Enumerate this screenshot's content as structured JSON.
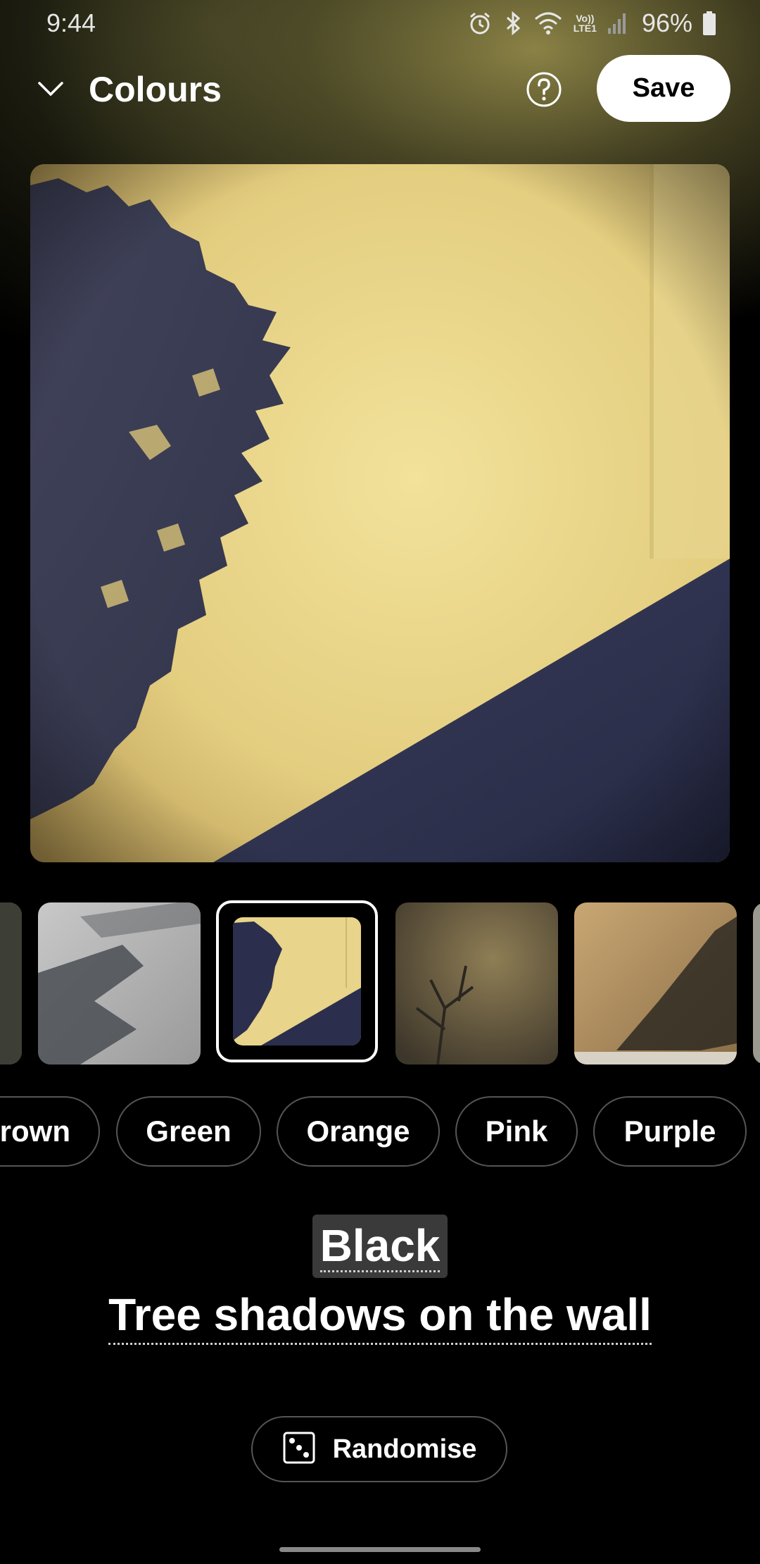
{
  "status_bar": {
    "time": "9:44",
    "battery": "96%",
    "icons": [
      "alarm-icon",
      "bluetooth-icon",
      "wifi-icon",
      "volte-icon",
      "signal-icon",
      "battery-icon"
    ],
    "volte_line1": "Vo))",
    "volte_line2": "LTE1"
  },
  "app_bar": {
    "title": "Colours",
    "save_label": "Save",
    "icons": [
      "chevron-down-icon",
      "help-icon"
    ]
  },
  "thumbnails": {
    "selected_index": 2,
    "count_visible": 6
  },
  "color_chips": {
    "items": [
      "rown",
      "Green",
      "Orange",
      "Pink",
      "Purple"
    ]
  },
  "caption": {
    "color_name": "Black",
    "wallpaper_title": "Tree shadows on the wall"
  },
  "randomise": {
    "label": "Randomise",
    "icon": "dice-icon"
  },
  "colors": {
    "background": "#000000",
    "wall_yellow": "#e8d48a",
    "shadow_navy": "#2b2f4d",
    "chip_border": "#555555",
    "save_bg": "#ffffff"
  }
}
